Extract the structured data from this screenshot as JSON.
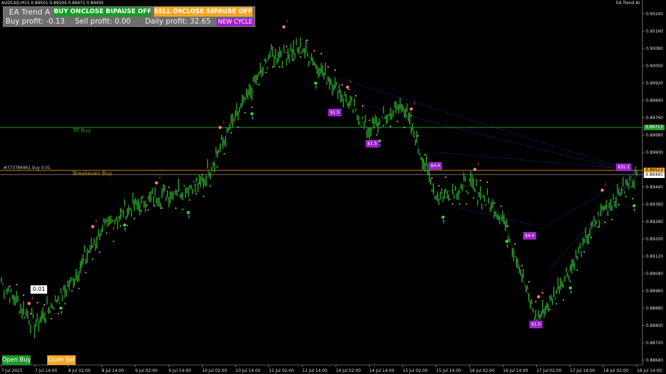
{
  "window": {
    "symbol_info": "AUDCAD,M15  0.89501 0.89504 0.89471 0.89495",
    "ea_name": "EA Trend AI"
  },
  "panel": {
    "title": "EA Trend A",
    "buy_on_label": "BUY ON",
    "close_buy_label": "CLOSE BUY",
    "pause_off_buy_label": "PAUSE OFF",
    "sell_on_label": "SELL ON",
    "close_sell_label": "CLOSE SEL",
    "pause_off_sell_label": "PAUSE OFF",
    "buy_profit": "Buy profit: -0.13",
    "sell_profit": "Sell profit: 0.00",
    "daily_profit": "Daily profit: 32.65",
    "new_cycle_label": "NEW CYCLE",
    "colors": {
      "buy": "#1a9a2a",
      "sell": "#f5a623",
      "panel": "#6e6e6e",
      "new_cycle": "#a020d0"
    }
  },
  "lines": {
    "tp_buy": "TP Buy",
    "breakeven_buy": "Breakeven Buy",
    "order": "#773786961 buy 0.01",
    "tp_price": "0.89713",
    "breakeven_price": "0.89513",
    "bid_price": "0.89495"
  },
  "badges": [
    "$1.5",
    "$1.5",
    "$4.4",
    "$4.4",
    "$1.5",
    "$31.1"
  ],
  "lot_size": "0.01",
  "open_buy_label": "Open Buy",
  "open_sell_label": "Open Sel",
  "price_axis": [
    "0.90240",
    "0.90160",
    "0.90080",
    "0.90000",
    "0.89920",
    "0.89840",
    "0.89760",
    "0.89680",
    "0.89600",
    "0.89520",
    "0.89440",
    "0.89360",
    "0.89280",
    "0.89200",
    "0.89120",
    "0.89040",
    "0.88960",
    "0.88880",
    "0.88800",
    "0.88720",
    "0.88640"
  ],
  "time_axis": [
    "7 Jul 2025",
    "7 Jul 14:00",
    "8 Jul 02:00",
    "8 Jul 14:00",
    "9 Jul 02:00",
    "9 Jul 14:00",
    "10 Jul 02:00",
    "10 Jul 14:00",
    "11 Jul 02:00",
    "11 Jul 14:00",
    "14 Jul 02:00",
    "14 Jul 14:00",
    "15 Jul 02:00",
    "15 Jul 14:00",
    "16 Jul 02:00",
    "16 Jul 14:00",
    "17 Jul 02:00",
    "17 Jul 14:00",
    "18 Jul 02:00",
    "18 Jul 14:00"
  ],
  "chart_data": {
    "type": "line",
    "price_range": [
      0.8864,
      0.9024
    ],
    "x": [
      "7 Jul 2025",
      "7 Jul 14:00",
      "8 Jul 02:00",
      "8 Jul 14:00",
      "9 Jul 02:00",
      "9 Jul 14:00",
      "10 Jul 02:00",
      "10 Jul 14:00",
      "11 Jul 02:00",
      "11 Jul 14:00",
      "14 Jul 02:00",
      "14 Jul 14:00",
      "15 Jul 02:00",
      "15 Jul 14:00",
      "16 Jul 02:00",
      "16 Jul 14:00",
      "17 Jul 02:00",
      "17 Jul 14:00",
      "18 Jul 02:00",
      "18 Jul 14:00"
    ],
    "series": [
      {
        "values": [
          0.89,
          0.888,
          0.8898,
          0.8924,
          0.8936,
          0.8941,
          0.8946,
          0.8976,
          0.9004,
          0.9008,
          0.899,
          0.897,
          0.8982,
          0.894,
          0.8945,
          0.893,
          0.8882,
          0.8906,
          0.8934,
          0.8949
        ]
      }
    ],
    "levels": {
      "tp_buy": 0.89713,
      "breakeven_buy": 0.89513,
      "bid": 0.89495
    },
    "grid": false
  }
}
